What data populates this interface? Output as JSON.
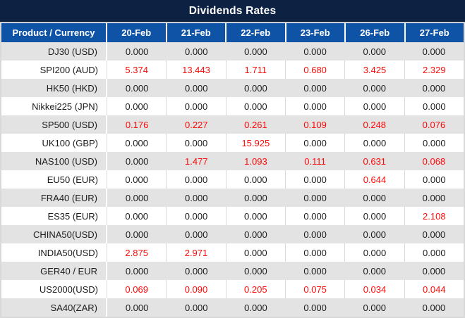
{
  "title": "Dividends Rates",
  "colors": {
    "title_bg": "#0d2143",
    "header_bg": "#0f53a6",
    "row_stripe_bg": "#e3e3e3",
    "value_zero_text": "#1c1c1c",
    "value_nonzero_text": "#fb0a08",
    "header_text": "#ffffff"
  },
  "chart_data": {
    "type": "table",
    "title": "Dividends Rates",
    "columns": [
      "Product / Currency",
      "20-Feb",
      "21-Feb",
      "22-Feb",
      "23-Feb",
      "26-Feb",
      "27-Feb"
    ],
    "rows": [
      [
        "DJ30 (USD)",
        "0.000",
        "0.000",
        "0.000",
        "0.000",
        "0.000",
        "0.000"
      ],
      [
        "SPI200 (AUD)",
        "5.374",
        "13.443",
        "1.711",
        "0.680",
        "3.425",
        "2.329"
      ],
      [
        "HK50 (HKD)",
        "0.000",
        "0.000",
        "0.000",
        "0.000",
        "0.000",
        "0.000"
      ],
      [
        "Nikkei225 (JPN)",
        "0.000",
        "0.000",
        "0.000",
        "0.000",
        "0.000",
        "0.000"
      ],
      [
        "SP500 (USD)",
        "0.176",
        "0.227",
        "0.261",
        "0.109",
        "0.248",
        "0.076"
      ],
      [
        "UK100 (GBP)",
        "0.000",
        "0.000",
        "15.925",
        "0.000",
        "0.000",
        "0.000"
      ],
      [
        "NAS100 (USD)",
        "0.000",
        "1.477",
        "1.093",
        "0.111",
        "0.631",
        "0.068"
      ],
      [
        "EU50 (EUR)",
        "0.000",
        "0.000",
        "0.000",
        "0.000",
        "0.644",
        "0.000"
      ],
      [
        "FRA40 (EUR)",
        "0.000",
        "0.000",
        "0.000",
        "0.000",
        "0.000",
        "0.000"
      ],
      [
        "ES35 (EUR)",
        "0.000",
        "0.000",
        "0.000",
        "0.000",
        "0.000",
        "2.108"
      ],
      [
        "CHINA50(USD)",
        "0.000",
        "0.000",
        "0.000",
        "0.000",
        "0.000",
        "0.000"
      ],
      [
        "INDIA50(USD)",
        "2.875",
        "2.971",
        "0.000",
        "0.000",
        "0.000",
        "0.000"
      ],
      [
        "GER40 / EUR",
        "0.000",
        "0.000",
        "0.000",
        "0.000",
        "0.000",
        "0.000"
      ],
      [
        "US2000(USD)",
        "0.069",
        "0.090",
        "0.205",
        "0.075",
        "0.034",
        "0.044"
      ],
      [
        "SA40(ZAR)",
        "0.000",
        "0.000",
        "0.000",
        "0.000",
        "0.000",
        "0.000"
      ]
    ]
  }
}
